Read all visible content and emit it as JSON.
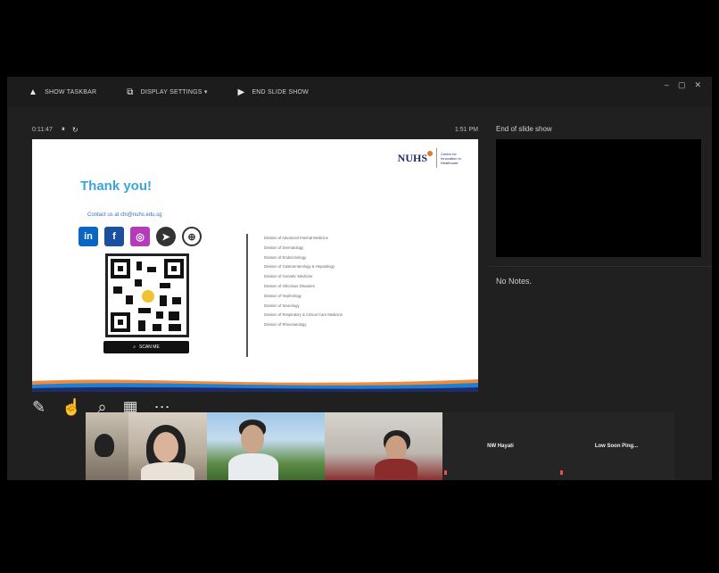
{
  "toolbar": {
    "items": [
      {
        "label": "Show Taskbar",
        "icon": "taskbar-icon"
      },
      {
        "label": "Display Settings ▾",
        "icon": "display-icon"
      },
      {
        "label": "End Slide Show",
        "icon": "end-show-icon"
      }
    ],
    "window_controls": [
      "–",
      "▢",
      "✕"
    ]
  },
  "presenter": {
    "timer": "0:11:47",
    "clock": "1:51 PM"
  },
  "slide": {
    "title": "Thank you!",
    "contact": "Contact us at chi@nuhs.edu.sg",
    "logo_text": "NUHS",
    "logo_subtext": "Centre for Innovation in Healthcare",
    "scan_button": "SCAN ME",
    "departments": [
      "Division of Advanced Internal Medicine",
      "Division of Dermatology",
      "Division of Endocrinology",
      "Division of Gastroenterology & Hepatology",
      "Division of Geriatric Medicine",
      "Division of Infectious Diseases",
      "Division of Nephrology",
      "Division of Neurology",
      "Division of Respiratory & Critical Care Medicine",
      "Division of Rheumatology"
    ]
  },
  "next_slide": {
    "label": "End of slide show"
  },
  "notes": {
    "label": "No Notes."
  },
  "participants": [
    {
      "name": "",
      "video": true
    },
    {
      "name": "",
      "video": true
    },
    {
      "name": "",
      "video": true
    },
    {
      "name": "",
      "video": true
    },
    {
      "name": "NW Hayati",
      "video": false
    },
    {
      "name": "Low Soon Ping...",
      "video": false
    }
  ],
  "colors": {
    "accent_blue": "#3ba4dc",
    "nuhs_navy": "#1f2b6b",
    "nuhs_orange": "#e07a2a",
    "mic_off": "#e5533c"
  }
}
